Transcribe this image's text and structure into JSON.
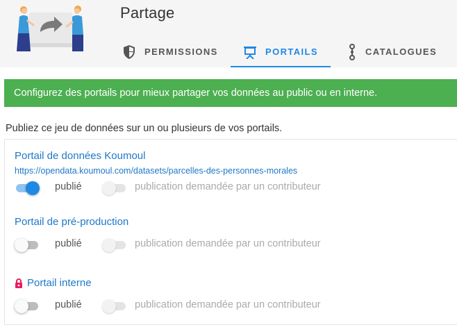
{
  "header": {
    "title": "Partage",
    "tabs": [
      {
        "label": "PERMISSIONS",
        "icon": "shield-icon",
        "active": false
      },
      {
        "label": "PORTAILS",
        "icon": "presentation-easel-icon",
        "active": true
      },
      {
        "label": "CATALOGUES",
        "icon": "chain-link-icon",
        "active": false
      }
    ]
  },
  "colors": {
    "accent": "#1e88e5",
    "banner": "#4caf50",
    "link": "#1e78c8",
    "lock": "#e91e63"
  },
  "banner": {
    "text": "Configurez des portails pour mieux partager vos données au public ou en interne."
  },
  "intro": "Publiez ce jeu de données sur un ou plusieurs de vos portails.",
  "portals": [
    {
      "name": "Portail de données Koumoul",
      "url": "https://opendata.koumoul.com/datasets/parcelles-des-personnes-morales",
      "published_label": "publié",
      "published": true,
      "request_label": "publication demandée par un contributeur",
      "requested": false
    },
    {
      "name": "Portail de pré-production",
      "published_label": "publié",
      "published": false,
      "request_label": "publication demandée par un contributeur",
      "requested": false
    },
    {
      "name": "Portail interne",
      "locked": true,
      "published_label": "publié",
      "published": false,
      "request_label": "publication demandée par un contributeur",
      "requested": false
    }
  ]
}
